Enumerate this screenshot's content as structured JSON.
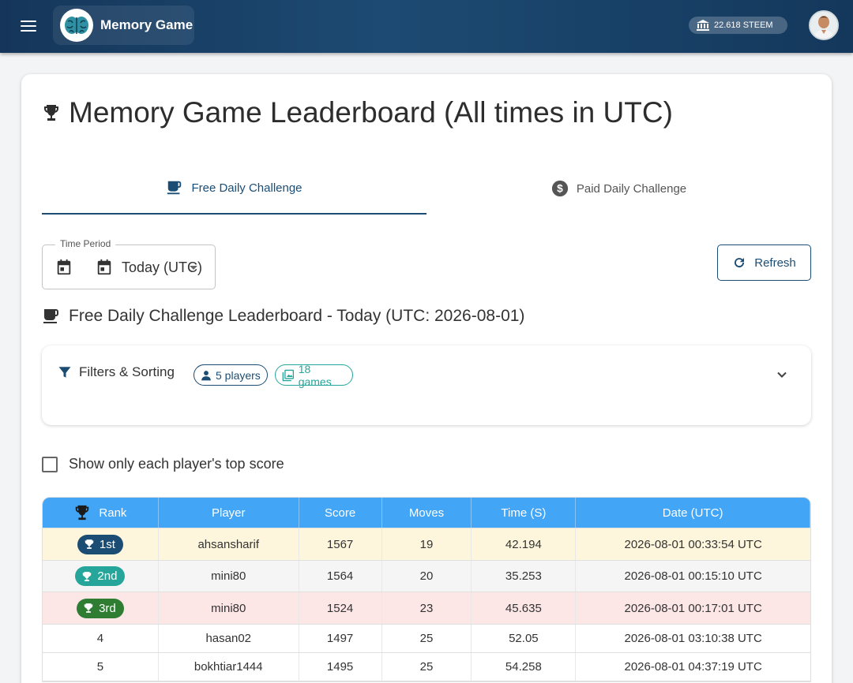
{
  "app": {
    "title": "Memory Game",
    "wallet": "22.618 STEEM"
  },
  "page": {
    "title": "Memory Game Leaderboard (All times in UTC)",
    "tabs": [
      {
        "label": "Free Daily Challenge",
        "active": true
      },
      {
        "label": "Paid Daily Challenge",
        "active": false
      }
    ],
    "time_period": {
      "label": "Time Period",
      "value": "Today (UTC)"
    },
    "refresh_label": "Refresh",
    "subtitle": "Free Daily Challenge Leaderboard - Today (UTC: 2026-08-01)",
    "filters": {
      "label": "Filters & Sorting",
      "players_chip": "5 players",
      "games_chip": "18 games"
    },
    "checkbox_label": "Show only each player's top score"
  },
  "table": {
    "headers": [
      "Rank",
      "Player",
      "Score",
      "Moves",
      "Time (S)",
      "Date (UTC)"
    ],
    "rows": [
      {
        "rank": "1st",
        "player": "ahsansharif",
        "score": "1567",
        "moves": "19",
        "time": "42.194",
        "date": "2026-08-01 00:33:54 UTC"
      },
      {
        "rank": "2nd",
        "player": "mini80",
        "score": "1564",
        "moves": "20",
        "time": "35.253",
        "date": "2026-08-01 00:15:10 UTC"
      },
      {
        "rank": "3rd",
        "player": "mini80",
        "score": "1524",
        "moves": "23",
        "time": "45.635",
        "date": "2026-08-01 00:17:01 UTC"
      },
      {
        "rank": "4",
        "player": "hasan02",
        "score": "1497",
        "moves": "25",
        "time": "52.05",
        "date": "2026-08-01 03:10:38 UTC"
      },
      {
        "rank": "5",
        "player": "bokhtiar1444",
        "score": "1495",
        "moves": "25",
        "time": "54.258",
        "date": "2026-08-01 04:37:19 UTC"
      }
    ]
  },
  "colors": {
    "appbar": "#1d4a72",
    "accent": "#1b4d74",
    "table_header": "#42a5f5",
    "gold_row": "#fdf6dc",
    "silver_row": "#f5f5f5",
    "bronze_row": "#fde6e6",
    "badge_1st": "#1b4d74",
    "badge_2nd": "#26a69a",
    "badge_3rd": "#2e7d32",
    "games_chip": "#26a69a"
  }
}
